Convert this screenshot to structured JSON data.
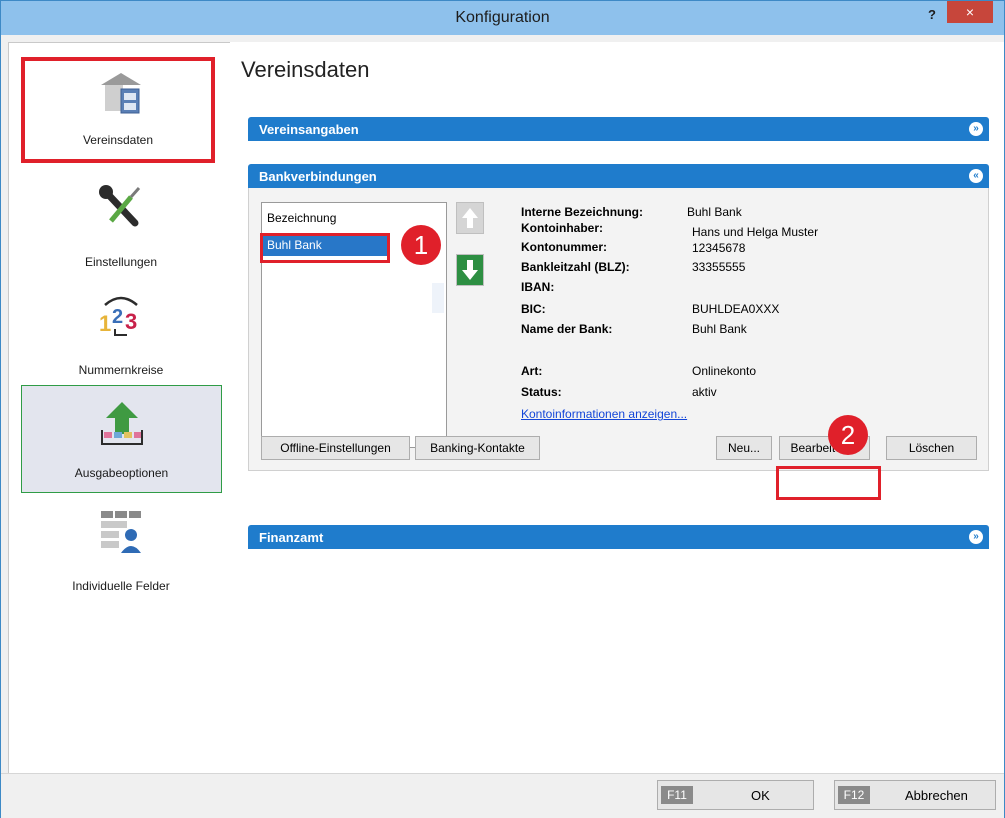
{
  "window": {
    "title": "Konfiguration",
    "help": "?",
    "close": "×"
  },
  "sidebar": {
    "items": [
      {
        "label": "Vereinsdaten",
        "icon": "house-cabinet-icon"
      },
      {
        "label": "Einstellungen",
        "icon": "wrench-screwdriver-icon"
      },
      {
        "label": "Nummernkreise",
        "icon": "number-sequence-icon"
      },
      {
        "label": "Ausgabeoptionen",
        "icon": "output-arrow-icon"
      },
      {
        "label": "Individuelle Felder",
        "icon": "custom-fields-icon"
      }
    ]
  },
  "main": {
    "title": "Vereinsdaten",
    "groups": {
      "vereinsangaben": "Vereinsangaben",
      "bankverbindungen": "Bankverbindungen",
      "finanzamt": "Finanzamt"
    },
    "bank": {
      "list_header": "Bezeichnung",
      "list_items": [
        "Buhl Bank"
      ],
      "details": [
        {
          "label": "Interne Bezeichnung:",
          "value": "Buhl Bank"
        },
        {
          "label": "Kontoinhaber:",
          "value": "Hans und Helga Muster"
        },
        {
          "label": "Kontonummer:",
          "value": "12345678"
        },
        {
          "label": "Bankleitzahl (BLZ):",
          "value": "33355555"
        },
        {
          "label": "IBAN:",
          "value": ""
        },
        {
          "label": "BIC:",
          "value": "BUHLDEA0XXX"
        },
        {
          "label": "Name der Bank:",
          "value": "Buhl Bank"
        },
        {
          "label": "Art:",
          "value": "Onlinekonto"
        },
        {
          "label": "Status:",
          "value": "aktiv"
        }
      ],
      "link": "Kontoinformationen anzeigen...",
      "buttons": {
        "offline": "Offline-Einstellungen",
        "kontakte": "Banking-Kontakte",
        "neu": "Neu...",
        "bearbeiten": "Bearbeiten...",
        "loeschen": "Löschen"
      }
    },
    "callouts": [
      "1",
      "2"
    ]
  },
  "footer": {
    "ok": {
      "key": "F11",
      "label": "OK"
    },
    "cancel": {
      "key": "F12",
      "label": "Abbrechen"
    }
  },
  "colors": {
    "accent": "#1f7ccc",
    "highlight": "#e0202a",
    "titlebar": "#8ec1ec"
  }
}
